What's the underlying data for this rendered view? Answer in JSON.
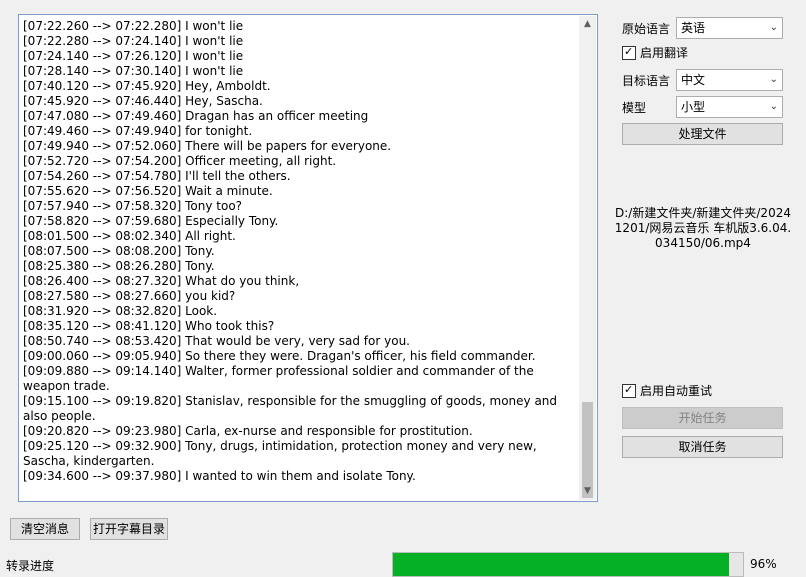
{
  "log_lines": [
    {
      "ts": "[07:22.260 --> 07:22.280]",
      "text": "I won't lie"
    },
    {
      "ts": "[07:22.280 --> 07:24.140]",
      "text": "I won't lie"
    },
    {
      "ts": "[07:24.140 --> 07:26.120]",
      "text": "I won't lie"
    },
    {
      "ts": "[07:28.140 --> 07:30.140]",
      "text": "I won't lie"
    },
    {
      "ts": "[07:40.120 --> 07:45.920]",
      "text": "Hey, Amboldt."
    },
    {
      "ts": "[07:45.920 --> 07:46.440]",
      "text": "Hey, Sascha."
    },
    {
      "ts": "[07:47.080 --> 07:49.460]",
      "text": "Dragan has an officer meeting"
    },
    {
      "ts": "[07:49.460 --> 07:49.940]",
      "text": "for tonight."
    },
    {
      "ts": "[07:49.940 --> 07:52.060]",
      "text": "There will be papers for everyone."
    },
    {
      "ts": "[07:52.720 --> 07:54.200]",
      "text": "Officer meeting, all right."
    },
    {
      "ts": "[07:54.260 --> 07:54.780]",
      "text": "I'll tell the others."
    },
    {
      "ts": "[07:55.620 --> 07:56.520]",
      "text": "Wait a minute."
    },
    {
      "ts": "[07:57.940 --> 07:58.320]",
      "text": "Tony too?"
    },
    {
      "ts": "[07:58.820 --> 07:59.680]",
      "text": "Especially Tony."
    },
    {
      "ts": "[08:01.500 --> 08:02.340]",
      "text": "All right."
    },
    {
      "ts": "[08:07.500 --> 08:08.200]",
      "text": "Tony."
    },
    {
      "ts": "[08:25.380 --> 08:26.280]",
      "text": "Tony."
    },
    {
      "ts": "[08:26.400 --> 08:27.320]",
      "text": "What do you think,"
    },
    {
      "ts": "[08:27.580 --> 08:27.660]",
      "text": "you kid?"
    },
    {
      "ts": "[08:31.920 --> 08:32.820]",
      "text": "Look."
    },
    {
      "ts": "[08:35.120 --> 08:41.120]",
      "text": "Who took this?"
    },
    {
      "ts": "[08:50.740 --> 08:53.420]",
      "text": "That would be very, very sad for you."
    },
    {
      "ts": "[09:00.060 --> 09:05.940]",
      "text": "So there they were. Dragan's officer, his field commander."
    },
    {
      "ts": "[09:09.880 --> 09:14.140]",
      "text": "Walter, former professional soldier and commander of the weapon trade."
    },
    {
      "ts": "[09:15.100 --> 09:19.820]",
      "text": "Stanislav, responsible for the smuggling of goods, money and also people."
    },
    {
      "ts": "[09:20.820 --> 09:23.980]",
      "text": "Carla, ex-nurse and responsible for prostitution."
    },
    {
      "ts": "[09:25.120 --> 09:32.900]",
      "text": "Tony, drugs, intimidation, protection money and very new, Sascha, kindergarten."
    },
    {
      "ts": "[09:34.600 --> 09:37.980]",
      "text": "I wanted to win them and isolate Tony."
    }
  ],
  "settings": {
    "source_lang_label": "原始语言",
    "source_lang_value": "英语",
    "enable_translate_label": "启用翻译",
    "enable_translate_checked": true,
    "target_lang_label": "目标语言",
    "target_lang_value": "中文",
    "model_label": "模型",
    "model_value": "小型",
    "process_file_label": "处理文件"
  },
  "file_path": "D:/新建文件夹/新建文件夹/20241201/网易云音乐 车机版3.6.04.034150/06.mp4",
  "tasks": {
    "auto_retry_label": "启用自动重试",
    "auto_retry_checked": true,
    "start_label": "开始任务",
    "cancel_label": "取消任务"
  },
  "bottom": {
    "clear_label": "清空消息",
    "open_dir_label": "打开字幕目录",
    "progress_label": "转录进度",
    "progress_value": 96,
    "progress_text": "96%"
  },
  "colors": {
    "progress_fill": "#06b025",
    "textbox_border": "#7a9cc7"
  }
}
